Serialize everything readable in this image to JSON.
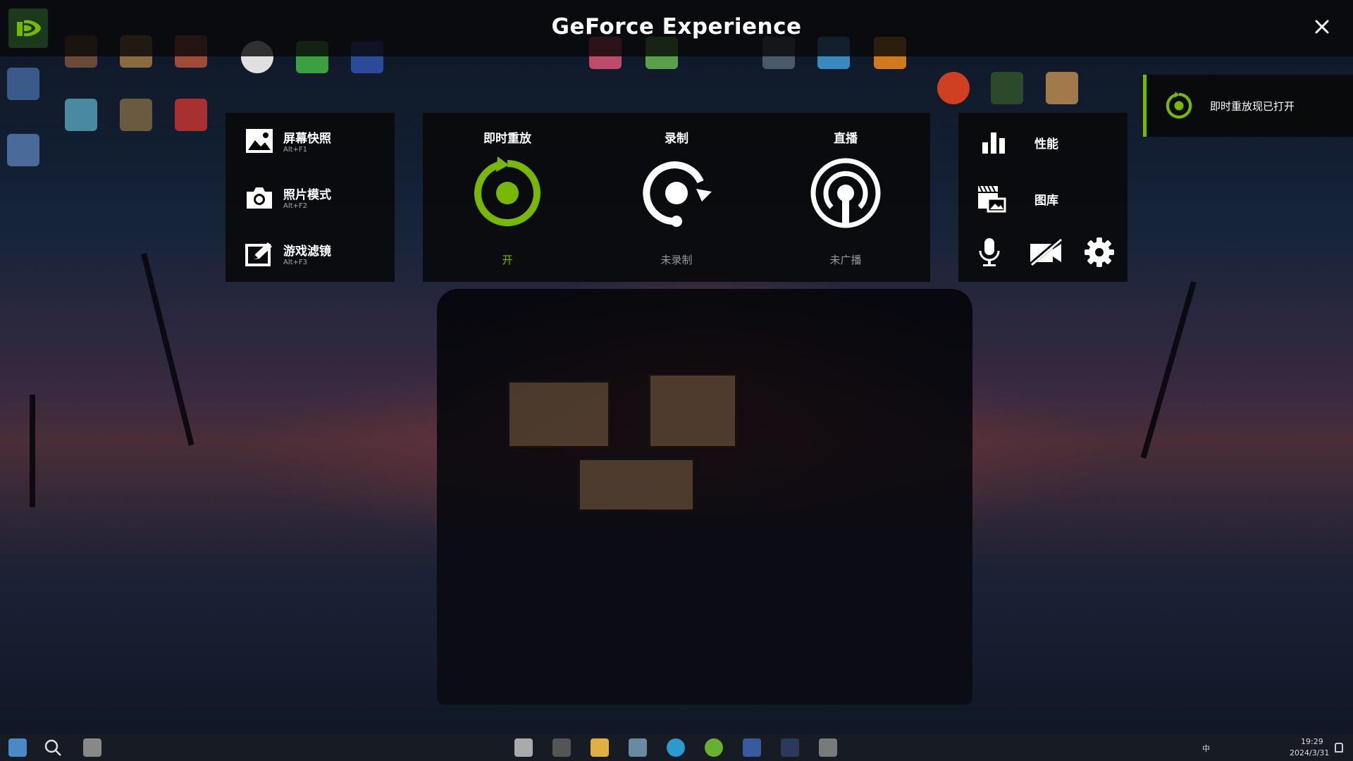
{
  "app": {
    "title": "GeForce Experience",
    "logo_icon": "nvidia-logo-icon",
    "close_icon": "close-icon",
    "accent_color": "#76b900"
  },
  "left_menu": [
    {
      "label": "屏幕快照",
      "shortcut": "Alt+F1",
      "icon": "image-icon"
    },
    {
      "label": "照片模式",
      "shortcut": "Alt+F2",
      "icon": "camera-icon"
    },
    {
      "label": "游戏滤镜",
      "shortcut": "Alt+F3",
      "icon": "filter-edit-icon"
    }
  ],
  "capture_modes": [
    {
      "label": "即时重放",
      "status": "开",
      "icon": "instant-replay-icon",
      "active": true
    },
    {
      "label": "录制",
      "status": "未录制",
      "icon": "record-icon",
      "active": false
    },
    {
      "label": "直播",
      "status": "未广播",
      "icon": "broadcast-icon",
      "active": false
    }
  ],
  "right_menu": {
    "performance": {
      "label": "性能",
      "icon": "performance-chart-icon"
    },
    "gallery": {
      "label": "图库",
      "icon": "gallery-icon"
    },
    "microphone_icon": "microphone-icon",
    "camera_off_icon": "camera-off-icon",
    "settings_icon": "gear-icon"
  },
  "toast": {
    "message": "即时重放现已打开",
    "icon": "instant-replay-icon"
  },
  "taskbar": {
    "time": "19:29",
    "date": "2024/3/31",
    "ime": "中"
  }
}
